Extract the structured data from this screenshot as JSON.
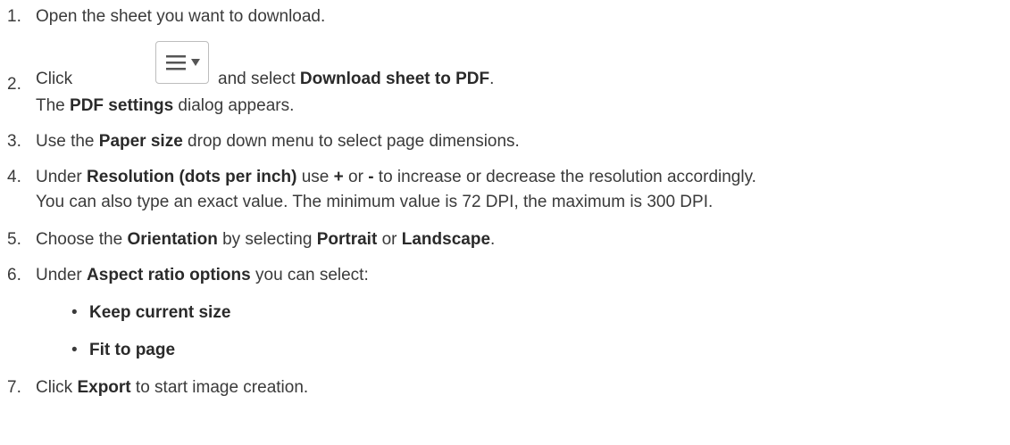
{
  "steps": [
    {
      "num": "1.",
      "a": "Open the sheet you want to download."
    },
    {
      "num": "2.",
      "a": "Click",
      "b": "and select ",
      "c": "Download sheet to PDF",
      "d": "."
    },
    {
      "line2a": "The ",
      "line2b": "PDF settings",
      "line2c": " dialog appears."
    },
    {
      "num": "3.",
      "a": "Use the ",
      "b": "Paper size",
      "c": " drop down menu to select page dimensions."
    },
    {
      "num": "4.",
      "a": "Under ",
      "b": "Resolution (dots per inch)",
      "c": " use ",
      "d": "+",
      "e": " or ",
      "f": "-",
      "g": " to increase or decrease the resolution accordingly."
    },
    {
      "line2": "You can also type an exact value. The minimum value is 72 DPI, the maximum is 300 DPI."
    },
    {
      "num": "5.",
      "a": "Choose the ",
      "b": "Orientation",
      "c": " by selecting ",
      "d": "Portrait",
      "e": " or ",
      "f": "Landscape",
      "g": "."
    },
    {
      "num": "6.",
      "a": "Under ",
      "b": "Aspect ratio options",
      "c": " you can select:"
    },
    {
      "bullet": "•",
      "text": "Keep current size"
    },
    {
      "bullet": "•",
      "text": "Fit to page"
    },
    {
      "num": "7.",
      "a": "Click ",
      "b": "Export",
      "c": " to start image creation."
    }
  ]
}
